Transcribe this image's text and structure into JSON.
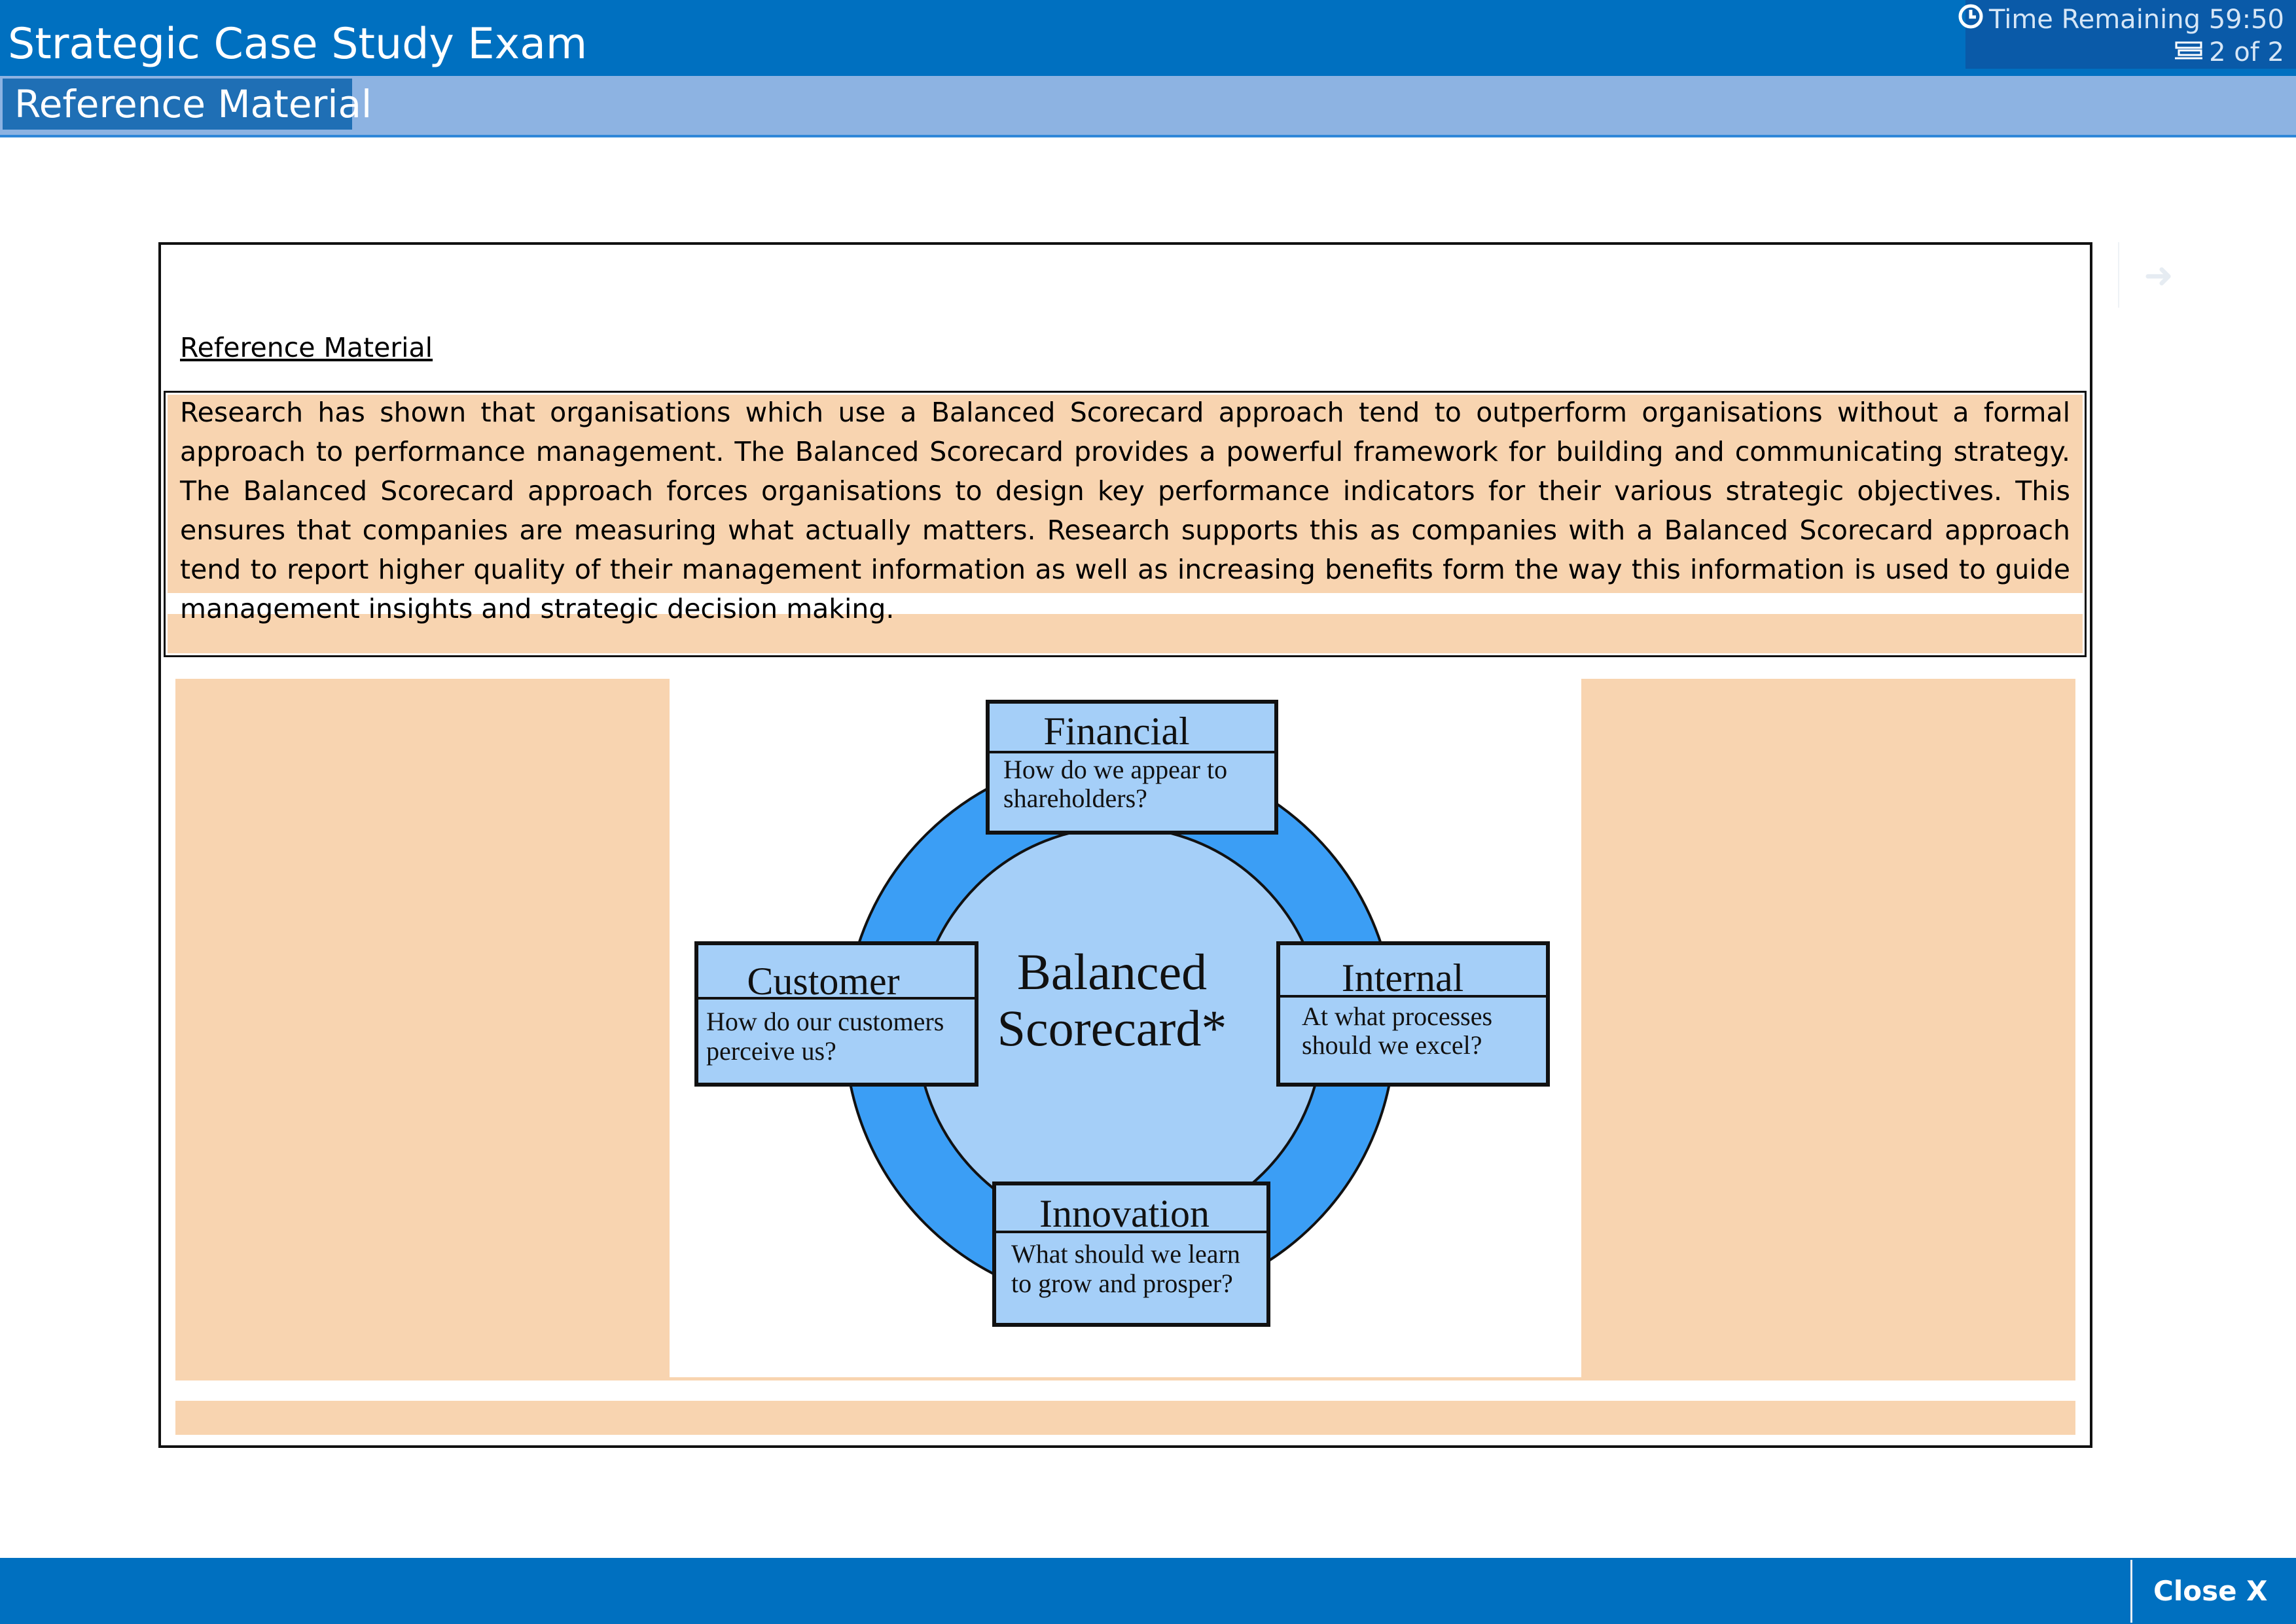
{
  "header": {
    "app_title": "Strategic Case Study Exam",
    "timer_icon": "clock-icon",
    "timer_label": "Time Remaining 59:50",
    "page_icon": "pages-icon",
    "page_indicator": "2 of 2",
    "tab_label": "Reference Material",
    "next_icon": "arrow-right-icon"
  },
  "content": {
    "heading": "Reference Material",
    "paragraph": "Research has shown that organisations which use a Balanced Scorecard approach tend to outperform organisations without a formal approach to performance management. The Balanced Scorecard provides a powerful framework for building and communicating strategy. The Balanced Scorecard approach forces organisations to design key performance indicators for their various strategic objectives. This ensures that companies are measuring what actually matters. Research supports this as companies with a Balanced Scorecard approach tend to report higher quality of their management information as well as increasing benefits form the way this information is used to guide management insights and strategic decision making."
  },
  "diagram": {
    "center_line1": "Balanced",
    "center_line2": "Scorecard*",
    "financial": {
      "title": "Financial",
      "line1": "How do we appear to",
      "line2": "shareholders?"
    },
    "customer": {
      "title": "Customer",
      "line1": "How do our customers",
      "line2": "perceive us?"
    },
    "internal": {
      "title": "Internal",
      "line1": "At what processes",
      "line2": "should we excel?"
    },
    "innovation": {
      "title": "Innovation",
      "line1": "What should we learn",
      "line2": "to grow and prosper?"
    },
    "colors": {
      "ring": "#3b9ef5",
      "inner": "#a5cff8",
      "box": "#a5cff8"
    }
  },
  "footer": {
    "close_label": "Close X"
  },
  "theme": {
    "primary": "#0070c0",
    "subbar": "#8db3e2",
    "highlight": "#f8d4b0"
  }
}
